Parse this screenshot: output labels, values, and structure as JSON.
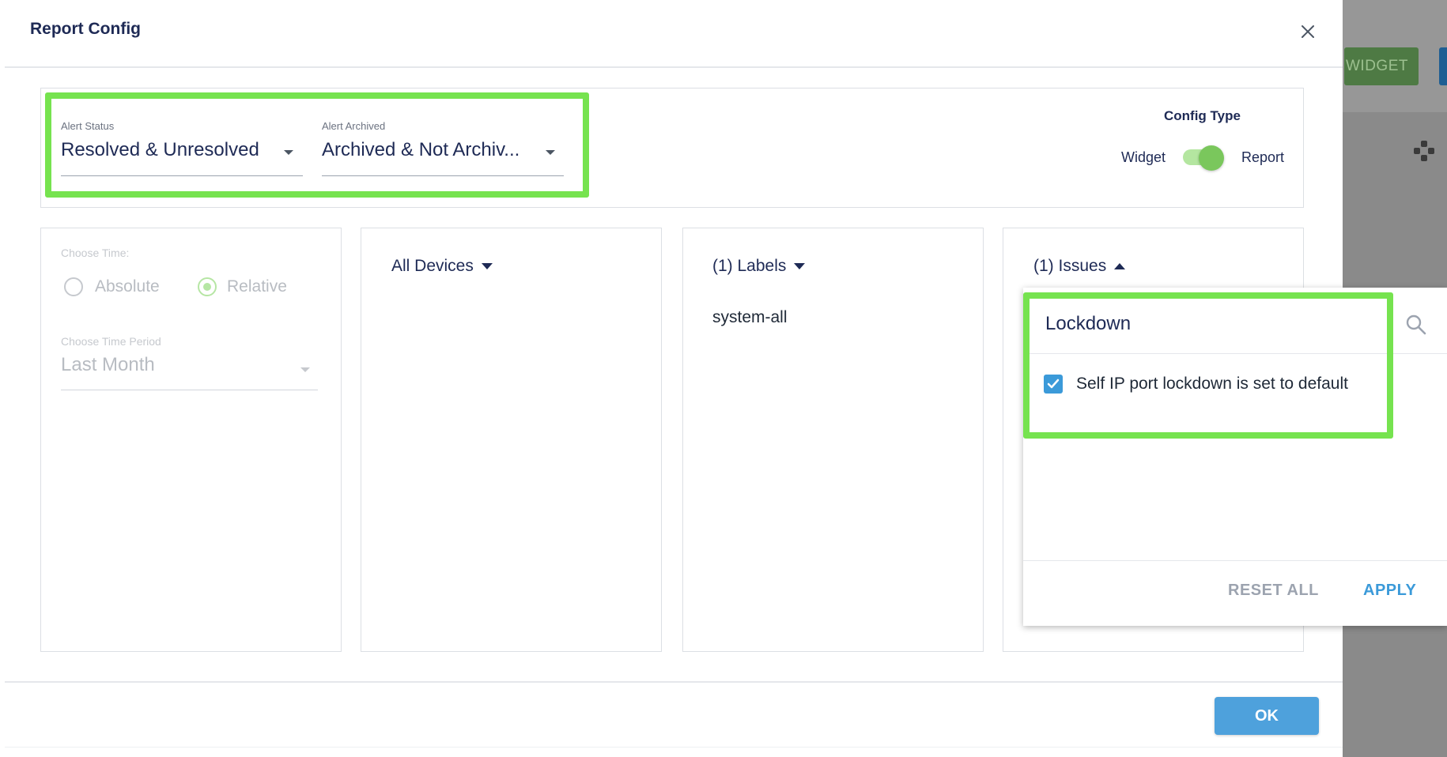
{
  "background": {
    "widget_button_label": "WIDGET"
  },
  "modal": {
    "title": "Report Config"
  },
  "filters": {
    "alert_status": {
      "label": "Alert Status",
      "value": "Resolved & Unresolved"
    },
    "alert_archived": {
      "label": "Alert Archived",
      "value": "Archived & Not Archiv..."
    }
  },
  "config_type": {
    "title": "Config Type",
    "left_label": "Widget",
    "right_label": "Report",
    "selected": "Report"
  },
  "time": {
    "choose_time_label": "Choose Time:",
    "options": [
      "Absolute",
      "Relative"
    ],
    "selected": "Relative",
    "period_label": "Choose Time Period",
    "period_value": "Last Month"
  },
  "devices": {
    "header": "All Devices"
  },
  "labels": {
    "header": "(1) Labels",
    "items": [
      "system-all"
    ]
  },
  "issues": {
    "header": "(1) Issues",
    "search_value": "Lockdown",
    "items": [
      {
        "label": "Self IP port lockdown is set to default",
        "checked": true
      }
    ],
    "reset_label": "RESET ALL",
    "apply_label": "APPLY"
  },
  "footer": {
    "ok_label": "OK"
  },
  "colors": {
    "highlight": "#76e34f",
    "primary_blue": "#4ea1dc",
    "toggle_green": "#7ac75c",
    "title_navy": "#1e2a55"
  }
}
